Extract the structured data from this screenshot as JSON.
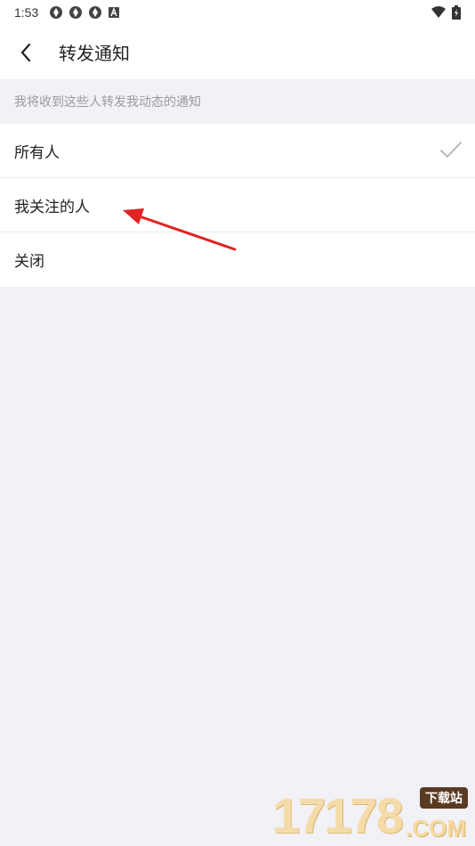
{
  "status_bar": {
    "time": "1:53",
    "left_icons": [
      "sync-icon",
      "sync-icon",
      "sync-icon",
      "font-a-icon"
    ],
    "right_icons": [
      "wifi-icon",
      "battery-charging-icon"
    ]
  },
  "header": {
    "back_icon": "chevron-left-icon",
    "title": "转发通知"
  },
  "section": {
    "hint": "我将收到这些人转发我动态的通知"
  },
  "options": [
    {
      "label": "所有人",
      "selected": true
    },
    {
      "label": "我关注的人",
      "selected": false
    },
    {
      "label": "关闭",
      "selected": false
    }
  ],
  "annotation": {
    "color": "#e02424"
  },
  "watermark": {
    "numbers": "17178",
    "domain": ".COM",
    "tag": "下载站"
  },
  "colors": {
    "background": "#f1f1f6",
    "surface": "#ffffff",
    "hint_text": "#9a9a9f",
    "check": "#b8b8bd"
  }
}
